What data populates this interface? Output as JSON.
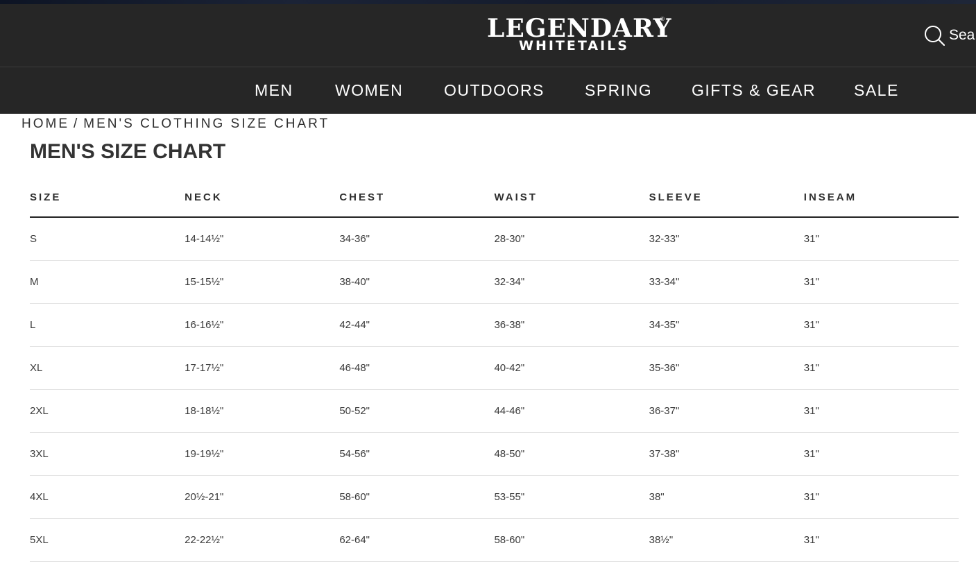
{
  "header": {
    "logo": {
      "line1": "LEGENDARY",
      "line2": "WHITETAILS",
      "mark": "®"
    },
    "search": {
      "label": "Sea",
      "icon": "search-icon"
    }
  },
  "nav": {
    "items": [
      {
        "label": "MEN"
      },
      {
        "label": "WOMEN"
      },
      {
        "label": "OUTDOORS"
      },
      {
        "label": "SPRING"
      },
      {
        "label": "GIFTS & GEAR"
      },
      {
        "label": "SALE"
      }
    ]
  },
  "breadcrumb": {
    "home": "HOME",
    "separator": "/",
    "current": "MEN'S CLOTHING SIZE CHART"
  },
  "page": {
    "title": "MEN'S SIZE CHART"
  },
  "size_table": {
    "headers": [
      "SIZE",
      "NECK",
      "CHEST",
      "WAIST",
      "SLEEVE",
      "INSEAM"
    ],
    "rows": [
      [
        "S",
        "14-14½\"",
        "34-36\"",
        "28-30\"",
        "32-33\"",
        "31\""
      ],
      [
        "M",
        "15-15½\"",
        "38-40\"",
        "32-34\"",
        "33-34\"",
        "31\""
      ],
      [
        "L",
        "16-16½\"",
        "42-44\"",
        "36-38\"",
        "34-35\"",
        "31\""
      ],
      [
        "XL",
        "17-17½\"",
        "46-48\"",
        "40-42\"",
        "35-36\"",
        "31\""
      ],
      [
        "2XL",
        "18-18½\"",
        "50-52\"",
        "44-46\"",
        "36-37\"",
        "31\""
      ],
      [
        "3XL",
        "19-19½\"",
        "54-56\"",
        "48-50\"",
        "37-38\"",
        "31\""
      ],
      [
        "4XL",
        "20½-21\"",
        "58-60\"",
        "53-55\"",
        "38\"",
        "31\""
      ],
      [
        "5XL",
        "22-22½\"",
        "62-64\"",
        "58-60\"",
        "38½\"",
        "31\""
      ]
    ]
  },
  "colors": {
    "header_bg": "#262626",
    "header_text": "#ffffff",
    "body_text": "#2a2a2a",
    "rule": "#222222",
    "row_divider": "#e4e4e4"
  }
}
